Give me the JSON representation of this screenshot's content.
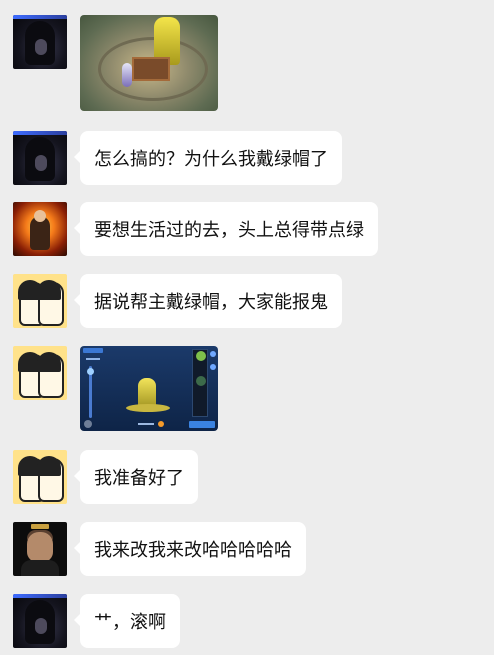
{
  "chat": {
    "messages": [
      {
        "type": "image",
        "avatar": "dark-avatar",
        "image": "game-screenshot-statue-platform"
      },
      {
        "type": "text",
        "avatar": "dark-avatar",
        "text": "怎么搞的？为什么我戴绿帽了"
      },
      {
        "type": "text",
        "avatar": "fire-monk-avatar",
        "text": "要想生活过的去，头上总得带点绿"
      },
      {
        "type": "text",
        "avatar": "couple-cartoon-avatar",
        "text": "据说帮主戴绿帽，大家能报鬼"
      },
      {
        "type": "image",
        "avatar": "couple-cartoon-avatar",
        "image": "game-screenshot-character-customization"
      },
      {
        "type": "text",
        "avatar": "couple-cartoon-avatar",
        "text": "我准备好了"
      },
      {
        "type": "text",
        "avatar": "man-portrait-avatar",
        "text": "我来改我来改哈哈哈哈哈"
      },
      {
        "type": "text",
        "avatar": "dark-avatar",
        "text": "艹，滚啊"
      }
    ]
  },
  "colors": {
    "background": "#ededed",
    "bubble": "#ffffff",
    "text": "#111111"
  }
}
